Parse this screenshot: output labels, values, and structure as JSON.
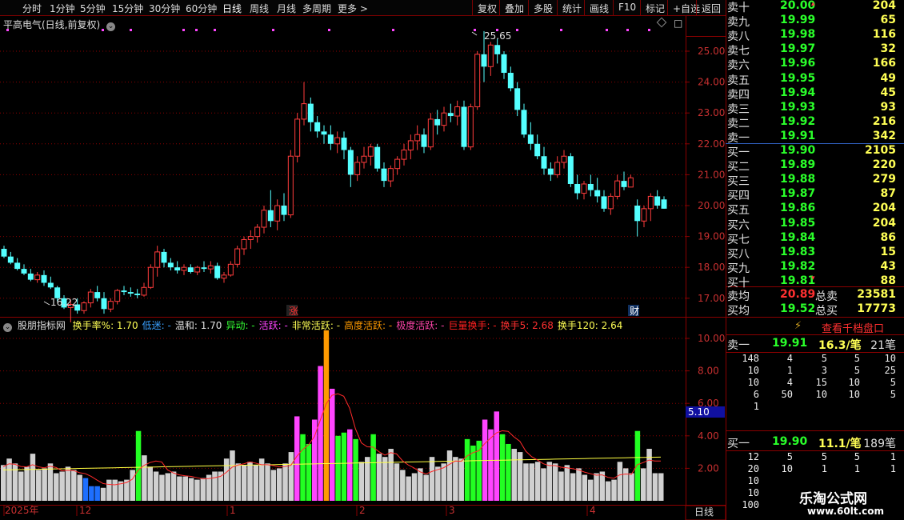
{
  "toolbar": {
    "left": [
      "分时",
      "1分钟",
      "5分钟",
      "15分钟",
      "30分钟",
      "60分钟",
      "日线",
      "周线",
      "月线",
      "多周期",
      "更多 >"
    ],
    "right": [
      "复权",
      "叠加",
      "多股",
      "统计",
      "画线",
      "F10",
      "标记",
      "+自选",
      "返回"
    ]
  },
  "main": {
    "title": "平高电气(日线,前复权)",
    "high_label": "25.65",
    "low_label": "16.22",
    "price_axis": [
      "25.00",
      "24.00",
      "23.00",
      "22.00",
      "21.00",
      "20.00",
      "19.00",
      "18.00",
      "17.00"
    ],
    "marker_zhang": "涨",
    "marker_cai": "财"
  },
  "indicator": {
    "name": "股朋指标网",
    "items": [
      {
        "t": "换手率%: 1.70",
        "c": "#ffff55"
      },
      {
        "t": "低迷: -",
        "c": "#3aa0ff"
      },
      {
        "t": "温和: 1.70",
        "c": "#e0e0e0"
      },
      {
        "t": "异动: -",
        "c": "#33ff33"
      },
      {
        "t": "活跃: -",
        "c": "#ff44ff"
      },
      {
        "t": "非常活跃: -",
        "c": "#ffff55"
      },
      {
        "t": "高度活跃: -",
        "c": "#ff9a00"
      },
      {
        "t": "极度活跃: -",
        "c": "#ff44aa"
      },
      {
        "t": "巨量换手: -",
        "c": "#ff2020"
      },
      {
        "t": "换手5: 2.68",
        "c": "#ff3030"
      },
      {
        "t": "换手120: 2.64",
        "c": "#ffff55"
      }
    ],
    "axis": [
      "10.00",
      "8.00",
      "6.00",
      "4.00",
      "2.00"
    ],
    "current_tag": "5.10"
  },
  "timeline": {
    "labels": [
      "2025年",
      "12",
      "1",
      "2",
      "3",
      "4"
    ],
    "period": "日线"
  },
  "order_book": {
    "asks": [
      {
        "n": "卖十",
        "p": "20.00",
        "v": "204"
      },
      {
        "n": "卖九",
        "p": "19.99",
        "v": "65"
      },
      {
        "n": "卖八",
        "p": "19.98",
        "v": "116"
      },
      {
        "n": "卖七",
        "p": "19.97",
        "v": "32"
      },
      {
        "n": "卖六",
        "p": "19.96",
        "v": "166"
      },
      {
        "n": "卖五",
        "p": "19.95",
        "v": "49"
      },
      {
        "n": "卖四",
        "p": "19.94",
        "v": "45"
      },
      {
        "n": "卖三",
        "p": "19.93",
        "v": "93"
      },
      {
        "n": "卖二",
        "p": "19.92",
        "v": "216"
      },
      {
        "n": "卖一",
        "p": "19.91",
        "v": "342"
      }
    ],
    "bids": [
      {
        "n": "买一",
        "p": "19.90",
        "v": "2105"
      },
      {
        "n": "买二",
        "p": "19.89",
        "v": "220"
      },
      {
        "n": "买三",
        "p": "19.88",
        "v": "279"
      },
      {
        "n": "买四",
        "p": "19.87",
        "v": "87"
      },
      {
        "n": "买五",
        "p": "19.86",
        "v": "204"
      },
      {
        "n": "买六",
        "p": "19.85",
        "v": "204"
      },
      {
        "n": "买七",
        "p": "19.84",
        "v": "86"
      },
      {
        "n": "买八",
        "p": "19.83",
        "v": "15"
      },
      {
        "n": "买九",
        "p": "19.82",
        "v": "43"
      },
      {
        "n": "买十",
        "p": "19.81",
        "v": "88"
      }
    ],
    "avg_sell_label": "卖均",
    "avg_sell": "20.89",
    "total_sell_label": "总卖",
    "total_sell": "23581",
    "avg_buy_label": "买均",
    "avg_buy": "19.52",
    "total_buy_label": "总买",
    "total_buy": "17773",
    "level2_button": "查看千档盘口",
    "ask1": {
      "label": "卖一",
      "price": "19.91",
      "per": "16.3/笔",
      "count": "21笔",
      "rows": [
        [
          "148",
          "4",
          "5",
          "5",
          "10"
        ],
        [
          "10",
          "1",
          "3",
          "5",
          "25"
        ],
        [
          "10",
          "4",
          "15",
          "10",
          "5"
        ],
        [
          "6",
          "50",
          "10",
          "10",
          "5"
        ],
        [
          "1",
          "",
          "",
          "",
          ""
        ]
      ]
    },
    "bid1": {
      "label": "买一",
      "price": "19.90",
      "per": "11.1/笔",
      "count": "189笔",
      "rows": [
        [
          "12",
          "5",
          "5",
          "5",
          "1"
        ],
        [
          "20",
          "10",
          "1",
          "1",
          "1"
        ],
        [
          "10",
          "",
          "",
          "",
          ""
        ],
        [
          "10",
          "",
          "",
          "",
          ""
        ],
        [
          "100",
          "",
          "",
          "",
          ""
        ]
      ]
    }
  },
  "watermark": {
    "name": "乐淘公式网",
    "url": "www.60lt.com"
  },
  "colors": {
    "up": "#ff3c3c",
    "down": "#54ffff",
    "ma5": "#ff2a2a",
    "ma120": "#ffff40",
    "border": "#8b0000"
  },
  "chart_data": [
    {
      "type": "candlestick",
      "title": "平高电气(日线,前复权)",
      "y_range": [
        16.2,
        26.0
      ],
      "x_labels": [
        "2025年",
        "12",
        "1",
        "2",
        "3",
        "4"
      ],
      "ohlc": [
        [
          18.6,
          18.7,
          18.3,
          18.35
        ],
        [
          18.35,
          18.5,
          18.1,
          18.15
        ],
        [
          18.15,
          18.3,
          17.9,
          17.95
        ],
        [
          17.95,
          18.1,
          17.75,
          17.8
        ],
        [
          17.8,
          17.95,
          17.55,
          17.6
        ],
        [
          17.6,
          17.85,
          17.5,
          17.75
        ],
        [
          17.75,
          17.9,
          17.4,
          17.5
        ],
        [
          17.5,
          17.7,
          17.3,
          17.35
        ],
        [
          17.35,
          17.4,
          16.9,
          17.0
        ],
        [
          17.0,
          17.1,
          16.65,
          16.7
        ],
        [
          16.7,
          16.95,
          16.22,
          16.8
        ],
        [
          16.8,
          17.0,
          16.5,
          16.6
        ],
        [
          16.6,
          16.9,
          16.5,
          16.85
        ],
        [
          16.85,
          17.3,
          16.7,
          17.2
        ],
        [
          17.2,
          17.4,
          16.9,
          17.0
        ],
        [
          17.0,
          17.2,
          16.5,
          16.65
        ],
        [
          16.65,
          17.0,
          16.55,
          16.9
        ],
        [
          16.9,
          17.3,
          16.8,
          17.25
        ],
        [
          17.25,
          17.4,
          17.1,
          17.2
        ],
        [
          17.2,
          17.35,
          17.05,
          17.15
        ],
        [
          17.15,
          17.3,
          17.0,
          17.1
        ],
        [
          17.1,
          17.5,
          17.05,
          17.35
        ],
        [
          17.35,
          18.1,
          17.3,
          18.0
        ],
        [
          18.0,
          18.7,
          17.7,
          18.5
        ],
        [
          18.5,
          18.6,
          18.0,
          18.15
        ],
        [
          18.15,
          18.3,
          17.9,
          18.0
        ],
        [
          18.0,
          18.2,
          17.8,
          17.9
        ],
        [
          17.9,
          18.1,
          17.75,
          18.0
        ],
        [
          18.0,
          18.1,
          17.8,
          17.85
        ],
        [
          17.85,
          18.05,
          17.75,
          18.0
        ],
        [
          18.0,
          18.2,
          17.85,
          17.95
        ],
        [
          17.95,
          18.2,
          17.8,
          18.05
        ],
        [
          18.05,
          18.15,
          17.6,
          17.65
        ],
        [
          17.65,
          17.85,
          17.5,
          17.75
        ],
        [
          17.75,
          18.2,
          17.7,
          18.1
        ],
        [
          18.1,
          18.7,
          18.0,
          18.6
        ],
        [
          18.6,
          19.0,
          18.4,
          18.9
        ],
        [
          18.9,
          19.2,
          18.6,
          19.0
        ],
        [
          19.0,
          19.4,
          18.8,
          19.3
        ],
        [
          19.3,
          20.0,
          19.1,
          19.85
        ],
        [
          19.85,
          20.5,
          19.3,
          19.5
        ],
        [
          19.5,
          20.2,
          19.2,
          20.0
        ],
        [
          20.0,
          20.4,
          19.5,
          19.7
        ],
        [
          19.7,
          21.8,
          19.6,
          21.6
        ],
        [
          21.6,
          23.0,
          21.4,
          22.8
        ],
        [
          22.8,
          24.0,
          22.6,
          23.3
        ],
        [
          23.3,
          23.5,
          22.4,
          22.7
        ],
        [
          22.7,
          22.9,
          22.2,
          22.4
        ],
        [
          22.4,
          22.6,
          22.0,
          22.3
        ],
        [
          22.3,
          22.6,
          21.8,
          22.0
        ],
        [
          22.0,
          22.4,
          21.7,
          22.2
        ],
        [
          22.2,
          22.4,
          21.5,
          21.8
        ],
        [
          21.8,
          21.9,
          20.6,
          21.0
        ],
        [
          21.0,
          21.6,
          20.8,
          21.4
        ],
        [
          21.4,
          21.9,
          21.2,
          21.6
        ],
        [
          21.6,
          22.0,
          21.3,
          21.9
        ],
        [
          21.9,
          22.0,
          21.1,
          21.2
        ],
        [
          21.2,
          21.4,
          20.6,
          20.8
        ],
        [
          20.8,
          21.3,
          20.6,
          21.2
        ],
        [
          21.2,
          21.6,
          21.0,
          21.5
        ],
        [
          21.5,
          22.0,
          21.3,
          21.8
        ],
        [
          21.8,
          22.3,
          21.5,
          22.1
        ],
        [
          22.1,
          22.6,
          21.8,
          22.3
        ],
        [
          22.3,
          22.5,
          21.7,
          21.9
        ],
        [
          21.9,
          23.0,
          21.8,
          22.8
        ],
        [
          22.8,
          23.1,
          22.3,
          22.6
        ],
        [
          22.6,
          23.2,
          22.4,
          23.0
        ],
        [
          23.0,
          23.3,
          22.7,
          22.9
        ],
        [
          22.9,
          23.4,
          22.6,
          23.2
        ],
        [
          23.2,
          23.4,
          21.8,
          21.9
        ],
        [
          21.9,
          23.3,
          21.8,
          23.2
        ],
        [
          23.2,
          25.0,
          23.1,
          24.9
        ],
        [
          24.9,
          25.65,
          24.0,
          24.5
        ],
        [
          24.5,
          25.3,
          24.2,
          25.2
        ],
        [
          25.2,
          25.4,
          24.6,
          24.9
        ],
        [
          24.9,
          25.0,
          24.1,
          24.3
        ],
        [
          24.3,
          24.5,
          23.7,
          23.8
        ],
        [
          23.8,
          24.0,
          22.9,
          23.1
        ],
        [
          23.1,
          23.3,
          22.2,
          22.3
        ],
        [
          22.3,
          22.7,
          21.8,
          22.0
        ],
        [
          22.0,
          22.3,
          21.5,
          21.6
        ],
        [
          21.6,
          21.9,
          21.0,
          21.2
        ],
        [
          21.2,
          21.4,
          20.8,
          21.0
        ],
        [
          21.0,
          21.6,
          20.9,
          21.4
        ],
        [
          21.4,
          21.8,
          21.2,
          21.6
        ],
        [
          21.6,
          21.7,
          20.6,
          20.7
        ],
        [
          20.7,
          21.0,
          20.2,
          20.4
        ],
        [
          20.4,
          20.8,
          20.2,
          20.7
        ],
        [
          20.7,
          21.0,
          20.3,
          20.5
        ],
        [
          20.5,
          20.9,
          20.1,
          20.3
        ],
        [
          20.3,
          20.5,
          19.8,
          19.9
        ],
        [
          19.9,
          20.4,
          19.7,
          20.3
        ],
        [
          20.3,
          21.0,
          20.2,
          20.8
        ],
        [
          20.8,
          21.1,
          20.5,
          20.6
        ],
        [
          20.6,
          21.0,
          20.6,
          20.9
        ],
        [
          20.0,
          20.2,
          19.0,
          19.5
        ],
        [
          19.5,
          20.0,
          19.3,
          19.9
        ],
        [
          19.9,
          20.4,
          19.5,
          20.3
        ],
        [
          20.3,
          20.5,
          19.9,
          20.0
        ],
        [
          20.2,
          20.3,
          19.9,
          19.9
        ]
      ]
    },
    {
      "type": "bar",
      "title": "股朋指标网",
      "y_range": [
        0,
        11
      ],
      "series": [
        {
          "name": "换手率%",
          "values": [
            2.2,
            2.6,
            2.3,
            1.8,
            2.1,
            2.9,
            1.9,
            2.0,
            2.3,
            1.7,
            1.8,
            2.1,
            1.9,
            1.6,
            1.4,
            0.9,
            0.9,
            0.8,
            1.3,
            1.3,
            1.2,
            1.3,
            1.9,
            4.3,
            2.8,
            2.1,
            1.8,
            1.6,
            1.7,
            1.8,
            1.5,
            1.5,
            1.4,
            1.3,
            1.4,
            1.6,
            1.8,
            1.8,
            2.6,
            3.1,
            2.3,
            2.2,
            2.4,
            2.2,
            2.6,
            2.3,
            1.9,
            2.0,
            2.3,
            3.0,
            5.2,
            4.1,
            3.5,
            5.0,
            8.3,
            10.5,
            6.9,
            4.0,
            4.2,
            4.4,
            3.8,
            2.4,
            2.7,
            4.1,
            2.9,
            2.7,
            3.2,
            2.3,
            1.9,
            1.5,
            1.7,
            2.0,
            1.6,
            2.7,
            2.1,
            2.3,
            3.1,
            2.7,
            2.6,
            3.8,
            3.4,
            3.7,
            5.0,
            4.4,
            5.5,
            4.1,
            3.5,
            3.2,
            3.0,
            2.3,
            2.3,
            2.4,
            2.0,
            2.4,
            2.3,
            1.8,
            2.2,
            1.7,
            2.0,
            1.6,
            1.3,
            1.7,
            1.8,
            1.2,
            1.3,
            2.4,
            2.0,
            1.7,
            4.3,
            2.0,
            3.2,
            1.7,
            1.7
          ]
        }
      ]
    }
  ]
}
